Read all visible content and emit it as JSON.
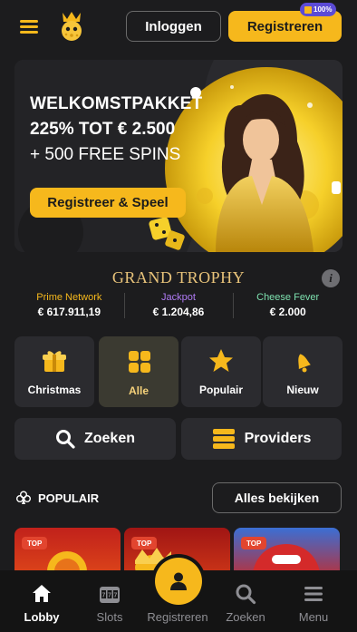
{
  "header": {
    "login_label": "Inloggen",
    "register_label": "Registreren",
    "bonus_badge": "100%"
  },
  "banner": {
    "line1": "WELKOMSTPAKKET",
    "line2": "225% TOT € 2.500",
    "line3": "+ 500 FREE SPINS",
    "cta_label": "Registreer & Speel"
  },
  "trophy": {
    "title": "GRAND TROPHY",
    "info_icon": "i",
    "jackpots": [
      {
        "name": "Prime Network",
        "value": "€ 617.911,19",
        "color": "#f6b81c"
      },
      {
        "name": "Jackpot",
        "value": "€ 1.204,86",
        "color": "#b07bf5"
      },
      {
        "name": "Cheese Fever",
        "value": "€ 2.000",
        "color": "#7ee2b0"
      }
    ]
  },
  "categories": [
    {
      "label": "Christmas",
      "icon": "gift-icon"
    },
    {
      "label": "Alle",
      "icon": "grid-icon",
      "active": true
    },
    {
      "label": "Populair",
      "icon": "star-icon"
    },
    {
      "label": "Nieuw",
      "icon": "bell-icon"
    }
  ],
  "actions": {
    "search_label": "Zoeken",
    "providers_label": "Providers"
  },
  "popular": {
    "title": "POPULAIR",
    "all_label": "Alles bekijken",
    "games": [
      {
        "badge": "TOP"
      },
      {
        "badge": "TOP"
      },
      {
        "badge": "TOP"
      }
    ]
  },
  "nav": {
    "items": [
      {
        "label": "Lobby",
        "icon": "home-icon",
        "active": true
      },
      {
        "label": "Slots",
        "icon": "slot-machine-icon"
      },
      {
        "label": "Registreren",
        "icon": "user-icon"
      },
      {
        "label": "Zoeken",
        "icon": "search-icon"
      },
      {
        "label": "Menu",
        "icon": "menu-icon"
      }
    ]
  },
  "colors": {
    "accent": "#f6b81c",
    "background": "#1c1c1e",
    "tile": "#2b2b2f"
  }
}
